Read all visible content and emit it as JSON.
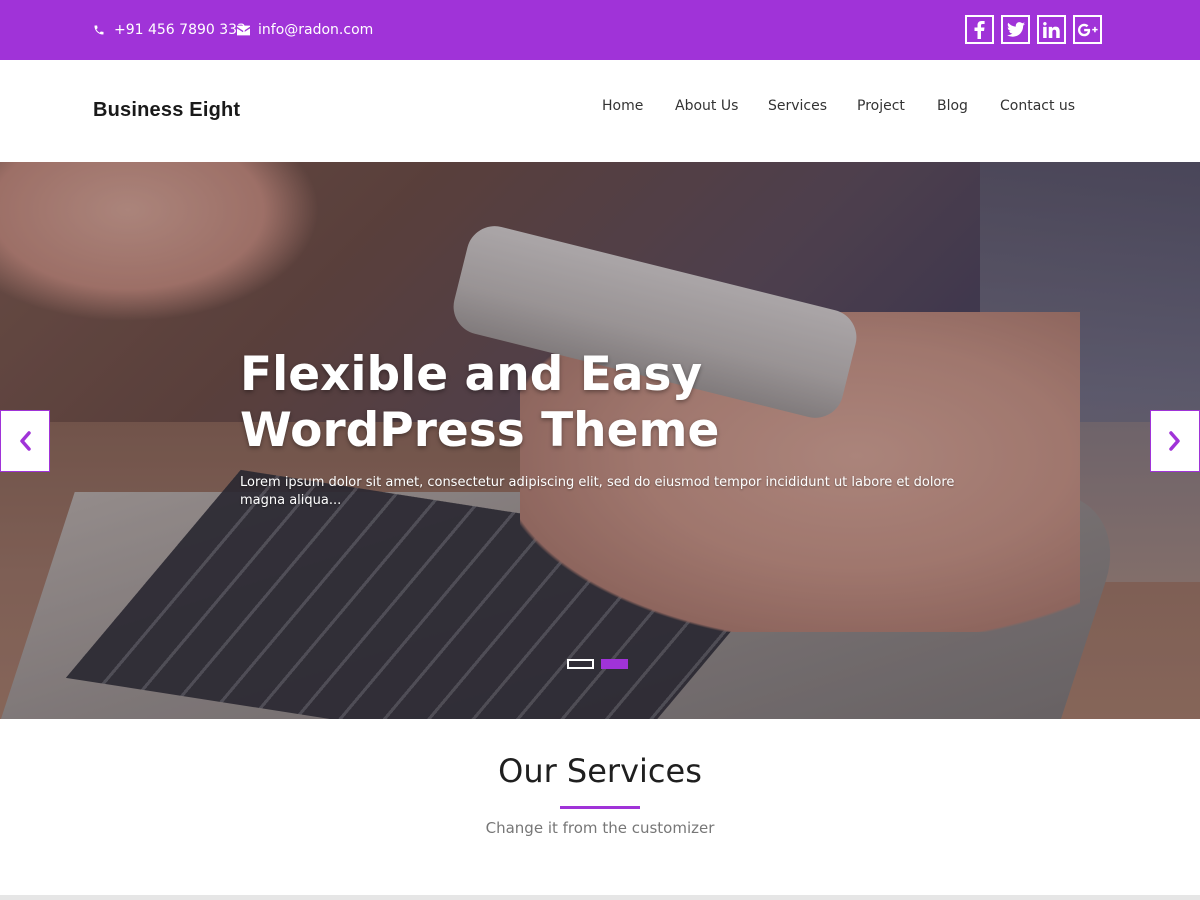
{
  "topbar": {
    "phone": "+91 456 7890 333",
    "email": "info@radon.com",
    "phone_icon": "phone-icon",
    "email_icon": "envelope-icon",
    "social": [
      {
        "name": "facebook-icon",
        "glyph": "f"
      },
      {
        "name": "twitter-icon",
        "glyph": "t"
      },
      {
        "name": "linkedin-icon",
        "glyph": "in"
      },
      {
        "name": "google-plus-icon",
        "glyph": "g+"
      }
    ],
    "accent_color": "#a033d8"
  },
  "header": {
    "brand": "Business Eight",
    "nav": [
      {
        "label": "Home"
      },
      {
        "label": "About Us"
      },
      {
        "label": "Services"
      },
      {
        "label": "Project"
      },
      {
        "label": "Blog"
      },
      {
        "label": "Contact us"
      }
    ]
  },
  "hero": {
    "title_line1": "Flexible and Easy",
    "title_line2": "WordPress Theme",
    "description": "Lorem ipsum dolor sit amet, consectetur adipiscing elit, sed do eiusmod tempor incididunt ut labore et dolore magna aliqua...",
    "prev_icon": "chevron-left-icon",
    "next_icon": "chevron-right-icon",
    "slides": 2,
    "active_slide": 2
  },
  "services": {
    "title": "Our Services",
    "subtitle": "Change it from the customizer"
  }
}
